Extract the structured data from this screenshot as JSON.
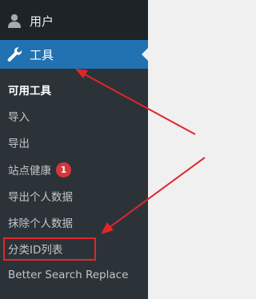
{
  "sidebar": {
    "users": {
      "label": "用户",
      "icon": "user-icon"
    },
    "tools": {
      "label": "工具",
      "icon": "wrench-icon"
    },
    "submenu": [
      {
        "label": "可用工具",
        "current": true
      },
      {
        "label": "导入"
      },
      {
        "label": "导出"
      },
      {
        "label": "站点健康",
        "badge": "1"
      },
      {
        "label": "导出个人数据"
      },
      {
        "label": "抹除个人数据"
      },
      {
        "label": "分类ID列表"
      },
      {
        "label": "Better Search Replace"
      }
    ]
  },
  "colors": {
    "sidebar_bg": "#1d2327",
    "submenu_bg": "#2c3338",
    "active_bg": "#2271b1",
    "badge_bg": "#d63638",
    "annotation_red": "#e0262b"
  }
}
